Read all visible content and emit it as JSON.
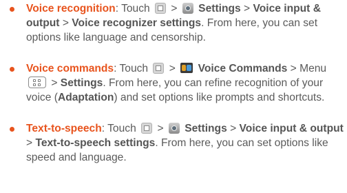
{
  "colors": {
    "accent": "#e8541e",
    "text": "#5a5a5a"
  },
  "icons": {
    "menu_key": "menu-key-icon",
    "settings": "settings-gear-icon",
    "voice_commands": "voice-commands-app-icon",
    "menu_button": "menu-button-icon"
  },
  "items": [
    {
      "term": "Voice recognition",
      "p1": ": Touch",
      "sep1": ">",
      "settings": "Settings",
      "sep2": ">",
      "voice_io": "Voice input & output",
      "sep3": ">",
      "target": "Voice recognizer settings",
      "tail": ". From here, you can set options like language and censorship."
    },
    {
      "term": "Voice commands",
      "p1": ": Touch",
      "sep1": ">",
      "app": "Voice Commands",
      "p2": "> Menu",
      "sep2": ">",
      "settings": "Settings",
      "p3": ". From here, you can refine recognition of your voice (",
      "adaptation": "Adaptation",
      "tail": ") and set options like prompts and shortcuts."
    },
    {
      "term": "Text-to-speech",
      "p1": ": Touch",
      "sep1": ">",
      "settings": "Settings",
      "sep2": ">",
      "voice_io": "Voice input & output",
      "sep3": ">",
      "target": "Text-to-speech settings",
      "tail": ". From here, you can set options like speed and language."
    }
  ]
}
